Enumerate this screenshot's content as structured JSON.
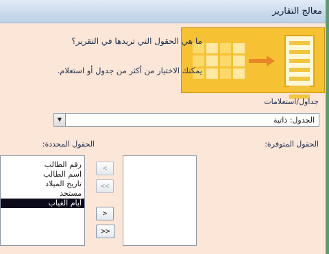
{
  "window": {
    "title": "معالج التقارير"
  },
  "intro": {
    "question": "ما هي الحقول التي تريدها في التقرير؟",
    "hint": "يمكنك الاختيار من أكثر من جدول أو استعلام."
  },
  "tables_queries": {
    "label": "جداول/استعلامات",
    "selected_value": "الجدول: ذاتية"
  },
  "available_fields": {
    "label": "الحقول المتوفرة:",
    "items": []
  },
  "selected_fields": {
    "label": "الحقول المحددة:",
    "items": [
      "رقم الطالب",
      "اسم الطالب",
      "تاريخ الميلاد",
      "مستجد",
      "أيام الغياب"
    ],
    "active_index": 4
  },
  "buttons": {
    "add_one": "<",
    "add_all": "<<",
    "remove_one": ">",
    "remove_all": ">>"
  },
  "icons": {
    "dropdown": "chevron-down-icon",
    "banner": "report-wizard-illustration-icon"
  },
  "colors": {
    "banner": "#f6c233",
    "dialog_background": "#fbe6d8",
    "titlebar": "#c9d9ec",
    "selection": "#0a0a1a"
  }
}
